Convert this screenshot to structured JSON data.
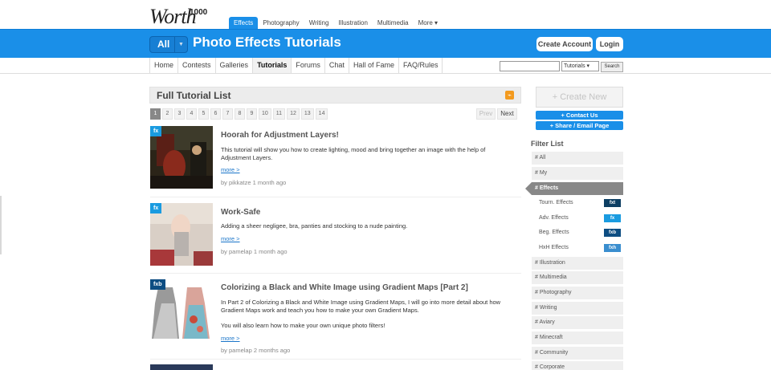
{
  "logo": {
    "text": "Worth",
    "sup": "1000"
  },
  "top_tabs": [
    "Effects",
    "Photography",
    "Writing",
    "Illustration",
    "Multimedia",
    "More ▾"
  ],
  "header": {
    "all_label": "All",
    "title": "Photo Effects Tutorials",
    "create_account": "Create Account",
    "login": "Login"
  },
  "nav": [
    "Home",
    "Contests",
    "Galleries",
    "Tutorials",
    "Forums",
    "Chat",
    "Hall of Fame",
    "FAQ/Rules"
  ],
  "search": {
    "select_value": "Tutorials",
    "button": "Search"
  },
  "list": {
    "title": "Full Tutorial List",
    "pages": [
      "1",
      "2",
      "3",
      "4",
      "5",
      "6",
      "7",
      "8",
      "9",
      "10",
      "11",
      "12",
      "13",
      "14"
    ],
    "prev": "Prev",
    "next": "Next",
    "entries": [
      {
        "badge": "fx",
        "title": "Hoorah for Adjustment Layers!",
        "desc": "This tutorial will show you how to create lighting, mood and bring together an image with the help of Adjustment Layers.",
        "more": "more >",
        "meta": "by pikkatze 1 month ago"
      },
      {
        "badge": "fx",
        "title": "Work-Safe",
        "desc": "Adding a sheer negligee, bra, panties and stocking to a nude painting.",
        "more": "more >",
        "meta": "by pamelap 1 month ago"
      },
      {
        "badge": "fxb",
        "title": "Colorizing a Black and White Image using Gradient Maps [Part 2]",
        "desc": "In Part 2 of Colorizing a Black and White Image using Gradient Maps, I will go into more detail about how Gradient Maps work and teach you how to make your own Gradient Maps.",
        "desc2": "You will also learn how to make your own unique photo filters!",
        "more": "more >",
        "meta": "by pamelap 2 months ago"
      }
    ]
  },
  "sidebar": {
    "create_new": "+ Create New",
    "contact": "+ Contact Us",
    "share": "+ Share / Email Page",
    "filter_title": "Filter List",
    "filters": [
      {
        "label": "# All"
      },
      {
        "label": "# My"
      },
      {
        "label": "# Effects"
      },
      {
        "label": "Tourn. Effects",
        "tag": "fxt"
      },
      {
        "label": "Adv. Effects",
        "tag": "fx"
      },
      {
        "label": "Beg. Effects",
        "tag": "fxb"
      },
      {
        "label": "HxH Effects",
        "tag": "fxh"
      },
      {
        "label": "# Illustration"
      },
      {
        "label": "# Multimedia"
      },
      {
        "label": "# Photography"
      },
      {
        "label": "# Writing"
      },
      {
        "label": "# Aviary"
      },
      {
        "label": "# Minecraft"
      },
      {
        "label": "# Community"
      },
      {
        "label": "# Corporate"
      }
    ]
  },
  "colors": {
    "accent": "#1a8fe8",
    "tag_fxt": "#0d3f63",
    "tag_fx": "#1a9be0",
    "tag_fxb": "#0d4d82",
    "tag_fxh": "#3a8ecf"
  }
}
